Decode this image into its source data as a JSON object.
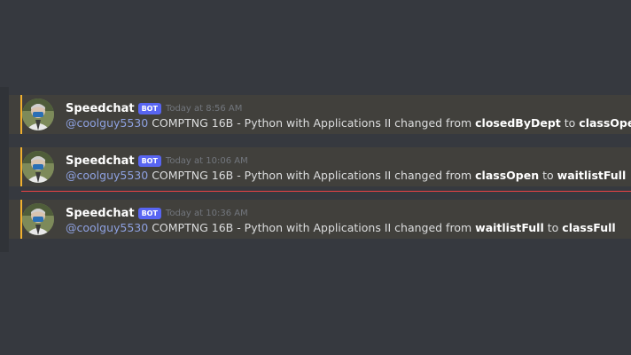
{
  "messages": [
    {
      "username": "Speedchat",
      "bot_tag": "BOT",
      "timestamp": "Today at 8:56 AM",
      "mention": "@coolguy5530",
      "course_text": "COMPTNG 16B - Python with Applications II changed from",
      "from_status": "closedByDept",
      "joiner": "to",
      "to_status": "classOpen"
    },
    {
      "username": "Speedchat",
      "bot_tag": "BOT",
      "timestamp": "Today at 10:06 AM",
      "mention": "@coolguy5530",
      "course_text": "COMPTNG 16B - Python with Applications II changed from",
      "from_status": "classOpen",
      "joiner": "to",
      "to_status": "waitlistFull"
    },
    {
      "username": "Speedchat",
      "bot_tag": "BOT",
      "timestamp": "Today at 10:36 AM",
      "mention": "@coolguy5530",
      "course_text": "COMPTNG 16B - Python with Applications II changed from",
      "from_status": "waitlistFull",
      "joiner": "to",
      "to_status": "classFull"
    }
  ],
  "colors": {
    "background": "#36393f",
    "message_highlight": "#41403c",
    "mention_accent": "#f1b02f",
    "bot_tag": "#5865f2",
    "mention_text": "#8ea1e1",
    "new_messages_divider": "#ed4245"
  }
}
